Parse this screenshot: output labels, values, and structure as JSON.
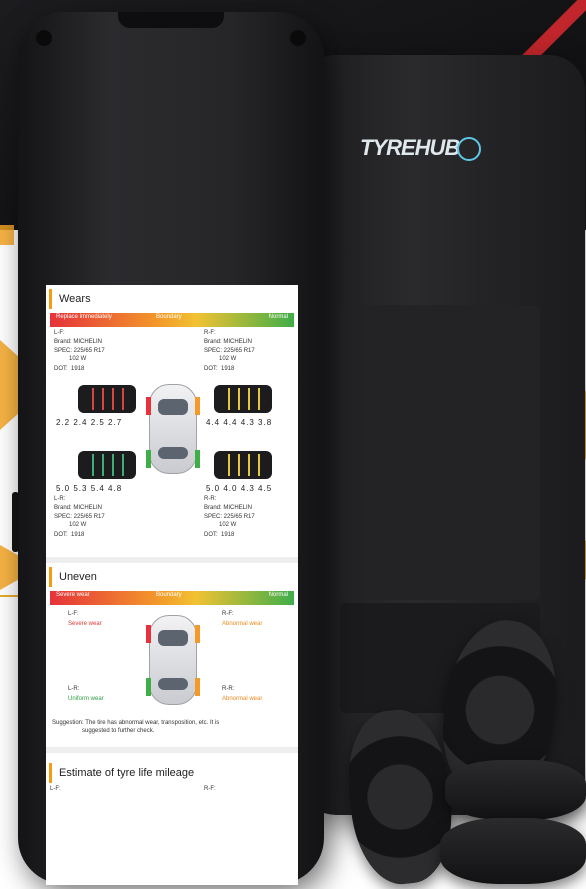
{
  "brand": {
    "logo_text": "TYREHUB"
  },
  "wears": {
    "title": "Wears",
    "scale": {
      "bad": "Replace immediately",
      "mid": "Boundary",
      "good": "Normal"
    },
    "lf": {
      "pos": "L-F:",
      "brand": "Brand: MICHELIN",
      "spec": "SPEC: 225/65 R17\n         102 W",
      "dot": "DOT:  1918",
      "depths": "2.2  2.4  2.5  2.7"
    },
    "rf": {
      "pos": "R-F:",
      "brand": "Brand: MICHELIN",
      "spec": "SPEC: 225/65 R17\n         102 W",
      "dot": "DOT:  1918",
      "depths": "4.4  4.4  4.3  3.8"
    },
    "lr": {
      "pos": "L-R:",
      "brand": "Brand: MICHELIN",
      "spec": "SPEC: 225/65 R17\n         102 W",
      "dot": "DOT:  1918",
      "depths": "5.0  5.3  5.4  4.8"
    },
    "rr": {
      "pos": "R-R:",
      "brand": "Brand: MICHELIN",
      "spec": "SPEC: 225/65 R17\n         102 W",
      "dot": "DOT:  1918",
      "depths": "5.0  4.0  4.3  4.5"
    }
  },
  "uneven": {
    "title": "Uneven",
    "scale": {
      "bad": "Severe wear",
      "mid": "Boundary",
      "good": "Normal"
    },
    "lf": {
      "pos": "L-F:",
      "status": "Severe wear"
    },
    "rf": {
      "pos": "R-F:",
      "status": "Abnormal wear"
    },
    "lr": {
      "pos": "L-R:",
      "status": "Uniform wear"
    },
    "rr": {
      "pos": "R-R:",
      "status": "Abnormal wear"
    },
    "suggestion": "Suggestion: The tire has abnormal wear, transposition, etc. It is\n                  suggested to further check."
  },
  "mileage": {
    "title": "Estimate of tyre life mileage",
    "lf": "L-F:",
    "rf": "R-F:"
  },
  "colors": {
    "accent": "#f39c12",
    "red": "#e5323b",
    "green": "#3fae49"
  }
}
